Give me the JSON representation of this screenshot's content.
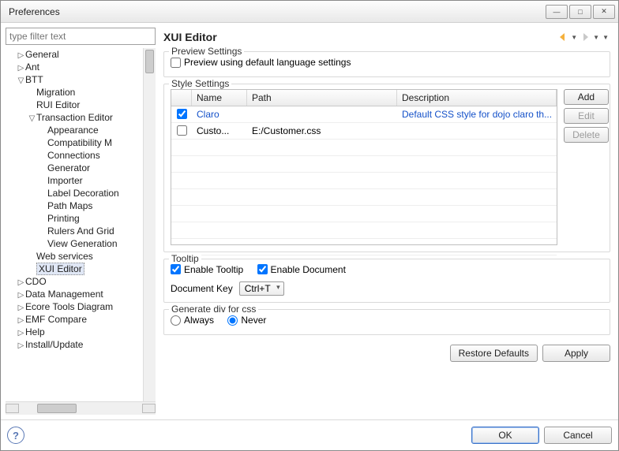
{
  "window": {
    "title": "Preferences"
  },
  "filter": {
    "placeholder": "type filter text"
  },
  "tree": [
    {
      "label": "General",
      "level": 1,
      "expander": "▷"
    },
    {
      "label": "Ant",
      "level": 1,
      "expander": "▷"
    },
    {
      "label": "BTT",
      "level": 1,
      "expander": "▽"
    },
    {
      "label": "Migration",
      "level": 2,
      "expander": ""
    },
    {
      "label": "RUI Editor",
      "level": 2,
      "expander": ""
    },
    {
      "label": "Transaction Editor",
      "level": 2,
      "expander": "▽"
    },
    {
      "label": "Appearance",
      "level": 3,
      "expander": ""
    },
    {
      "label": "Compatibility M",
      "level": 3,
      "expander": ""
    },
    {
      "label": "Connections",
      "level": 3,
      "expander": ""
    },
    {
      "label": "Generator",
      "level": 3,
      "expander": ""
    },
    {
      "label": "Importer",
      "level": 3,
      "expander": ""
    },
    {
      "label": "Label Decoration",
      "level": 3,
      "expander": ""
    },
    {
      "label": "Path Maps",
      "level": 3,
      "expander": ""
    },
    {
      "label": "Printing",
      "level": 3,
      "expander": ""
    },
    {
      "label": "Rulers And Grid",
      "level": 3,
      "expander": ""
    },
    {
      "label": "View Generation",
      "level": 3,
      "expander": ""
    },
    {
      "label": "Web services",
      "level": 2,
      "expander": ""
    },
    {
      "label": "XUI Editor",
      "level": 2,
      "expander": "",
      "selected": true
    },
    {
      "label": "CDO",
      "level": 1,
      "expander": "▷"
    },
    {
      "label": "Data Management",
      "level": 1,
      "expander": "▷"
    },
    {
      "label": "Ecore Tools Diagram",
      "level": 1,
      "expander": "▷"
    },
    {
      "label": "EMF Compare",
      "level": 1,
      "expander": "▷"
    },
    {
      "label": "Help",
      "level": 1,
      "expander": "▷"
    },
    {
      "label": "Install/Update",
      "level": 1,
      "expander": "▷"
    }
  ],
  "page": {
    "title": "XUI Editor",
    "preview": {
      "legend": "Preview Settings",
      "defaultLang": "Preview using default language settings"
    },
    "style": {
      "legend": "Style Settings",
      "columns": {
        "name": "Name",
        "path": "Path",
        "description": "Description"
      },
      "rows": [
        {
          "checked": true,
          "name": "Claro",
          "path": "",
          "desc": "Default CSS style for dojo claro th...",
          "link": true
        },
        {
          "checked": false,
          "name": "Custo...",
          "path": "E:/Customer.css",
          "desc": "",
          "link": false
        }
      ],
      "buttons": {
        "add": "Add",
        "edit": "Edit",
        "delete": "Delete"
      }
    },
    "tooltip": {
      "legend": "Tooltip",
      "enableTooltip": "Enable Tooltip",
      "enableDocument": "Enable Document",
      "docKeyLabel": "Document Key",
      "docKeyValue": "Ctrl+T"
    },
    "gencss": {
      "legend": "Generate div for css",
      "always": "Always",
      "never": "Never"
    },
    "restore": "Restore Defaults",
    "apply": "Apply"
  },
  "dialog": {
    "ok": "OK",
    "cancel": "Cancel"
  }
}
